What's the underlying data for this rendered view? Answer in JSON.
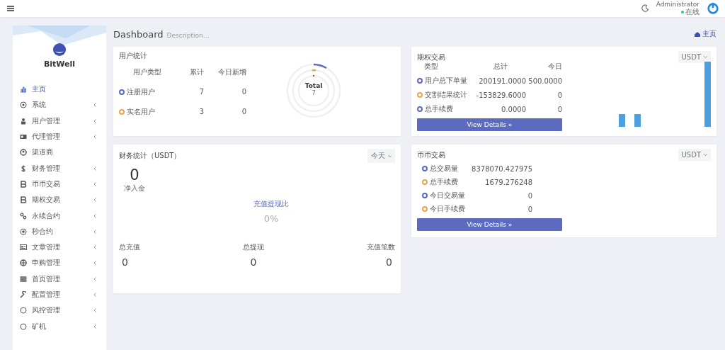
{
  "topbar": {
    "user": "Administrator",
    "status": "在线"
  },
  "sidebar": {
    "brand": "BitWell",
    "items": [
      {
        "label": "主页",
        "selected": true,
        "expandable": false
      },
      {
        "label": "系统",
        "selected": false,
        "expandable": true
      },
      {
        "label": "用户管理",
        "selected": false,
        "expandable": true
      },
      {
        "label": "代理管理",
        "selected": false,
        "expandable": true
      },
      {
        "label": "渠道商",
        "selected": false,
        "expandable": false
      },
      {
        "label": "财务管理",
        "selected": false,
        "expandable": true
      },
      {
        "label": "币币交易",
        "selected": false,
        "expandable": true
      },
      {
        "label": "期权交易",
        "selected": false,
        "expandable": true
      },
      {
        "label": "永续合约",
        "selected": false,
        "expandable": true
      },
      {
        "label": "秒合约",
        "selected": false,
        "expandable": true
      },
      {
        "label": "文章管理",
        "selected": false,
        "expandable": true
      },
      {
        "label": "申购管理",
        "selected": false,
        "expandable": true
      },
      {
        "label": "首页管理",
        "selected": false,
        "expandable": true
      },
      {
        "label": "配置管理",
        "selected": false,
        "expandable": true
      },
      {
        "label": "风控管理",
        "selected": false,
        "expandable": true
      },
      {
        "label": "矿机",
        "selected": false,
        "expandable": true
      }
    ]
  },
  "header": {
    "title": "Dashboard",
    "description": "Description...",
    "breadcrumb": "主页"
  },
  "user_stats": {
    "title": "用户统计",
    "columns": [
      "用户类型",
      "累计",
      "今日新增"
    ],
    "rows": [
      {
        "name": "注册用户",
        "total": "7",
        "today": "0",
        "color": "#5c6bc0"
      },
      {
        "name": "实名用户",
        "total": "3",
        "today": "0",
        "color": "#e0a84e"
      }
    ],
    "center_label": "Total",
    "center_value": "7"
  },
  "options": {
    "title": "期权交易",
    "currency": "USDT",
    "columns": [
      "类型",
      "总计",
      "今日"
    ],
    "rows": [
      {
        "name": "用户总下单量",
        "total": "200191.0000",
        "today": "500.0000",
        "color": "#5c6bc0"
      },
      {
        "name": "交割结果统计",
        "total": "-153829.6000",
        "today": "0",
        "color": "#e0a84e"
      },
      {
        "name": "总手续费",
        "total": "0.0000",
        "today": "0",
        "color": "#5c6bc0"
      }
    ],
    "button": "View Details »"
  },
  "finance": {
    "title": "财务统计（USDT）",
    "period": "今天",
    "net_value": "0",
    "net_label": "净入金",
    "ratio_label": "充值提现比",
    "ratio_value": "0%",
    "totals": [
      {
        "label": "总充值",
        "value": "0"
      },
      {
        "label": "总提现",
        "value": "0"
      },
      {
        "label": "充值笔数",
        "value": "0"
      }
    ]
  },
  "spot": {
    "title": "币币交易",
    "currency": "USDT",
    "rows": [
      {
        "name": "总交易量",
        "value": "8378070.427975",
        "color": "#5c6bc0"
      },
      {
        "name": "总手续费",
        "value": "1679.276248",
        "color": "#e0a84e"
      },
      {
        "name": "今日交易量",
        "value": "0",
        "color": "#5c6bc0"
      },
      {
        "name": "今日手续费",
        "value": "0",
        "color": "#e0a84e"
      }
    ],
    "button": "View Details »"
  }
}
